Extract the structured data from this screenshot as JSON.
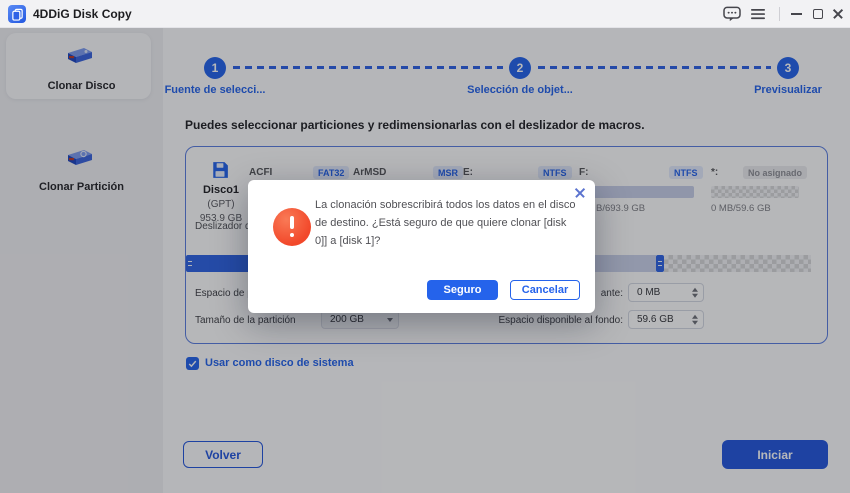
{
  "titlebar": {
    "app_title": "4DDiG Disk Copy"
  },
  "sidebar": {
    "items": [
      {
        "label": "Clonar Disco"
      },
      {
        "label": "Clonar Partición"
      }
    ]
  },
  "stepper": {
    "steps": [
      {
        "num": "1",
        "label": "Fuente de selecci..."
      },
      {
        "num": "2",
        "label": "Selección de objet..."
      },
      {
        "num": "3",
        "label": "Previsualizar"
      }
    ]
  },
  "main": {
    "instruction": "Puedes seleccionar particiones y redimensionarlas con el deslizador de macros.",
    "disk": {
      "name": "Disco1",
      "scheme": "(GPT)",
      "size": "953.9 GB"
    },
    "partitions": [
      {
        "name": "ACFI",
        "fs": "FAT32"
      },
      {
        "name": "ArMSD",
        "fs": "MSR"
      },
      {
        "name": "E:",
        "fs": "NTFS"
      },
      {
        "name": "F:",
        "fs": "NTFS"
      },
      {
        "name": "*:",
        "fs": "No asignado"
      }
    ],
    "usage_ntfs": "B/693.9 GB",
    "usage_unallocated": "0 MB/59.6 GB",
    "slider_label": "Deslizador de r",
    "space_before_label": "Espacio de pa",
    "front_space_label": "ante:",
    "front_space_value": "0 MB",
    "partition_size_label": "Tamaño de la partición",
    "partition_size_value": "200 GB",
    "back_space_label": "Espacio disponible al fondo:",
    "back_space_value": "59.6 GB",
    "system_disk_checkbox": "Usar como disco de sistema",
    "back_button": "Volver",
    "start_button": "Iniciar"
  },
  "dialog": {
    "message": "La clonación sobrescribirá todos los datos en el disco de destino. ¿Está seguro de que quiere clonar [disk 0]] a [disk 1]?",
    "confirm_button": "Seguro",
    "cancel_button": "Cancelar"
  },
  "colors": {
    "accent": "#2563eb",
    "warning": "#f2482a"
  }
}
